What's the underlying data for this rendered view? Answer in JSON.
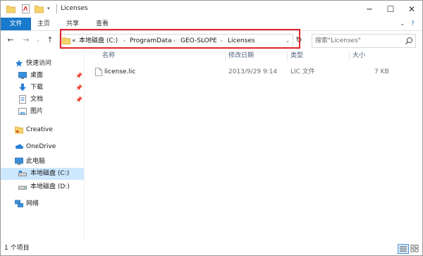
{
  "window": {
    "title": "Licenses",
    "controls": {
      "minimize": "─",
      "maximize": "☐",
      "close": "✕"
    },
    "quick_access_arrow": "▾"
  },
  "ribbon": {
    "tabs": [
      "文件",
      "主页",
      "共享",
      "查看"
    ],
    "collapse_glyph": "⌄",
    "help_glyph": "?"
  },
  "nav": {
    "back": "←",
    "forward": "→",
    "recent": "⌄",
    "up": "↑",
    "refresh": "↻"
  },
  "address": {
    "overflow": "«",
    "crumbs": [
      "本地磁盘 (C:)",
      "ProgramData",
      "GEO-SLOPE",
      "Licenses"
    ],
    "separator": "›",
    "dropdown": "⌄"
  },
  "search": {
    "placeholder": "搜索\"Licenses\""
  },
  "sidebar": {
    "items": [
      {
        "label": "快速访问",
        "icon": "star-icon",
        "pin": ""
      },
      {
        "label": "桌面",
        "icon": "desktop-icon",
        "pin": "📌"
      },
      {
        "label": "下载",
        "icon": "download-icon",
        "pin": "📌"
      },
      {
        "label": "文档",
        "icon": "document-icon",
        "pin": "📌"
      },
      {
        "label": "图片",
        "icon": "picture-icon",
        "pin": ""
      },
      {
        "label": "Creative",
        "icon": "folder-icon",
        "pin": ""
      },
      {
        "label": "OneDrive",
        "icon": "cloud-icon",
        "pin": ""
      },
      {
        "label": "此电脑",
        "icon": "computer-icon",
        "pin": ""
      },
      {
        "label": "本地磁盘 (C:)",
        "icon": "drive-icon",
        "pin": ""
      },
      {
        "label": "本地磁盘 (D:)",
        "icon": "drive-icon",
        "pin": ""
      },
      {
        "label": "网络",
        "icon": "network-icon",
        "pin": ""
      }
    ]
  },
  "columns": {
    "name": "名称",
    "modified": "修改日期",
    "type": "类型",
    "size": "大小"
  },
  "files": [
    {
      "name": "license.lic",
      "modified": "2013/9/29 9:14",
      "type": "LIC 文件",
      "size": "7 KB"
    }
  ],
  "status": {
    "count": "1 个项目"
  },
  "colors": {
    "accent": "#1979ca",
    "selection": "#cce8ff",
    "highlight_border": "#e2232a"
  }
}
